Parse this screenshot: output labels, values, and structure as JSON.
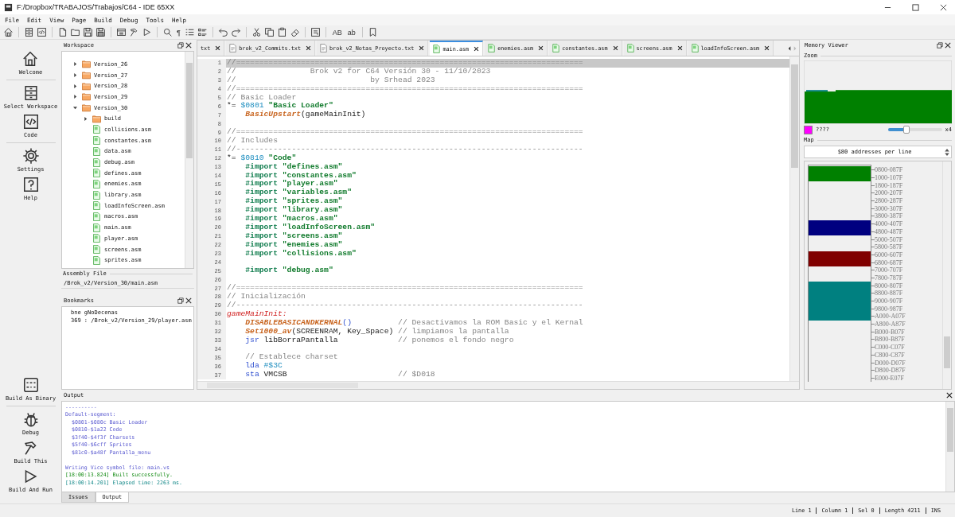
{
  "window": {
    "title": "F:/Dropbox/TRABAJOS/Trabajos/C64 - IDE 65XX"
  },
  "menu": [
    "File",
    "Edit",
    "View",
    "Page",
    "Build",
    "Debug",
    "Tools",
    "Help"
  ],
  "toolbar": [
    {
      "kind": "home"
    },
    {
      "kind": "separator"
    },
    {
      "kind": "cabinet"
    },
    {
      "kind": "code"
    },
    {
      "kind": "separator"
    },
    {
      "kind": "file"
    },
    {
      "kind": "folder"
    },
    {
      "kind": "save"
    },
    {
      "kind": "saveall"
    },
    {
      "kind": "separator"
    },
    {
      "kind": "panel"
    },
    {
      "kind": "hammer"
    },
    {
      "kind": "play"
    },
    {
      "kind": "separator"
    },
    {
      "kind": "search"
    },
    {
      "kind": "text",
      "label": "¶"
    },
    {
      "kind": "list"
    },
    {
      "kind": "checklist"
    },
    {
      "kind": "separator"
    },
    {
      "kind": "undo"
    },
    {
      "kind": "redo"
    },
    {
      "kind": "separator"
    },
    {
      "kind": "cut"
    },
    {
      "kind": "copy"
    },
    {
      "kind": "paste"
    },
    {
      "kind": "eraser"
    },
    {
      "kind": "separator"
    },
    {
      "kind": "block"
    },
    {
      "kind": "separator"
    },
    {
      "kind": "text",
      "label": "AB"
    },
    {
      "kind": "text",
      "label": "ab"
    },
    {
      "kind": "separator"
    },
    {
      "kind": "bookmark"
    }
  ],
  "sidebar": {
    "top": [
      {
        "kind": "home",
        "label": "Welcome"
      },
      {
        "kind": "cabinet",
        "label": "Select Workspace"
      },
      {
        "kind": "code",
        "label": "Code"
      },
      {
        "kind": "gear",
        "label": "Settings"
      },
      {
        "kind": "help",
        "label": "Help"
      }
    ],
    "bottom": [
      {
        "kind": "binary",
        "label": "Build As Binary"
      },
      {
        "kind": "bug",
        "label": "Debug"
      },
      {
        "kind": "hammer",
        "label": "Build This"
      },
      {
        "kind": "play",
        "label": "Build And Run"
      }
    ]
  },
  "workspace": {
    "title": "Workspace",
    "tree": [
      {
        "name": "Version_26",
        "kind": "folder",
        "expanded": false
      },
      {
        "name": "Version_27",
        "kind": "folder",
        "expanded": false
      },
      {
        "name": "Version_28",
        "kind": "folder",
        "expanded": false
      },
      {
        "name": "Version_29",
        "kind": "folder",
        "expanded": false
      },
      {
        "name": "Version_30",
        "kind": "folder",
        "expanded": true,
        "children": [
          {
            "name": "build",
            "kind": "folder",
            "expanded": false
          },
          {
            "name": "collisions.asm",
            "kind": "asm"
          },
          {
            "name": "constantes.asm",
            "kind": "asm"
          },
          {
            "name": "data.asm",
            "kind": "asm"
          },
          {
            "name": "debug.asm",
            "kind": "asm"
          },
          {
            "name": "defines.asm",
            "kind": "asm"
          },
          {
            "name": "enemies.asm",
            "kind": "asm"
          },
          {
            "name": "library.asm",
            "kind": "asm"
          },
          {
            "name": "loadInfoScreen.asm",
            "kind": "asm"
          },
          {
            "name": "macros.asm",
            "kind": "asm"
          },
          {
            "name": "main.asm",
            "kind": "asm"
          },
          {
            "name": "player.asm",
            "kind": "asm"
          },
          {
            "name": "screens.asm",
            "kind": "asm"
          },
          {
            "name": "sprites.asm",
            "kind": "asm"
          }
        ]
      }
    ],
    "assembly_file_label": "Assembly File",
    "assembly_file": "/Brok_v2/Version_30/main.asm"
  },
  "bookmarks": {
    "title": "Bookmarks",
    "items": [
      {
        "instruction": "bne gNoDecenas",
        "location": "369 : /Brok_v2/Version_29/player.asm"
      }
    ]
  },
  "editor": {
    "tabs": [
      {
        "label": "txt",
        "kind": "cut",
        "selected": false
      },
      {
        "label": "brok_v2_Commits.txt",
        "kind": "txt",
        "selected": false
      },
      {
        "label": "brok_v2_Notas_Proyecto.txt",
        "kind": "txt",
        "selected": false
      },
      {
        "label": "main.asm",
        "kind": "asm",
        "selected": true
      },
      {
        "label": "enemies.asm",
        "kind": "asm",
        "selected": false
      },
      {
        "label": "constantes.asm",
        "kind": "asm",
        "selected": false
      },
      {
        "label": "screens.asm",
        "kind": "asm",
        "selected": false
      },
      {
        "label": "loadInfoScreen.asm",
        "kind": "asm",
        "selected": false
      }
    ],
    "lines": [
      {
        "number": "1",
        "current": true,
        "segments": [
          {
            "kind": "comment",
            "text": "//==========================================================================="
          }
        ]
      },
      {
        "number": "2",
        "current": false,
        "segments": [
          {
            "kind": "comment",
            "text": "//                Brok v2 for C64 Versión 30 - 11/10/2023"
          }
        ]
      },
      {
        "number": "3",
        "current": false,
        "segments": [
          {
            "kind": "comment",
            "text": "//                             by Srhead 2023"
          }
        ]
      },
      {
        "number": "4",
        "current": false,
        "segments": [
          {
            "kind": "comment",
            "text": "//==========================================================================="
          }
        ]
      },
      {
        "number": "5",
        "current": false,
        "segments": [
          {
            "kind": "comment",
            "text": "// Basic Loader"
          }
        ]
      },
      {
        "number": "6",
        "current": false,
        "segments": [
          {
            "kind": "plain",
            "text": "*= "
          },
          {
            "kind": "number",
            "text": "$0801"
          },
          {
            "kind": "string",
            "text": " \"Basic Loader\""
          }
        ]
      },
      {
        "number": "7",
        "current": false,
        "segments": [
          {
            "kind": "macro",
            "text": "    BasicUpstart"
          },
          {
            "kind": "plain",
            "text": "(gameMainInit)"
          }
        ]
      },
      {
        "number": "8",
        "current": false
      },
      {
        "number": "9",
        "current": false,
        "segments": [
          {
            "kind": "comment",
            "text": "//==========================================================================="
          }
        ]
      },
      {
        "number": "10",
        "current": false,
        "segments": [
          {
            "kind": "comment",
            "text": "// Includes"
          }
        ]
      },
      {
        "number": "11",
        "current": false,
        "segments": [
          {
            "kind": "comment",
            "text": "//---------------------------------------------------------------------------"
          }
        ]
      },
      {
        "number": "12",
        "current": false,
        "segments": [
          {
            "kind": "plain",
            "text": "*= "
          },
          {
            "kind": "number",
            "text": "$0810"
          },
          {
            "kind": "string",
            "text": " \"Code\""
          }
        ]
      },
      {
        "number": "13",
        "current": false,
        "segments": [
          {
            "kind": "directive",
            "text": "    #import"
          },
          {
            "kind": "string",
            "text": " \"defines.asm\""
          }
        ]
      },
      {
        "number": "14",
        "current": false,
        "segments": [
          {
            "kind": "directive",
            "text": "    #import"
          },
          {
            "kind": "string",
            "text": " \"constantes.asm\""
          }
        ]
      },
      {
        "number": "15",
        "current": false,
        "segments": [
          {
            "kind": "directive",
            "text": "    #import"
          },
          {
            "kind": "string",
            "text": " \"player.asm\""
          }
        ]
      },
      {
        "number": "16",
        "current": false,
        "segments": [
          {
            "kind": "directive",
            "text": "    #import"
          },
          {
            "kind": "string",
            "text": " \"variables.asm\""
          }
        ]
      },
      {
        "number": "17",
        "current": false,
        "segments": [
          {
            "kind": "directive",
            "text": "    #import"
          },
          {
            "kind": "string",
            "text": " \"sprites.asm\""
          }
        ]
      },
      {
        "number": "18",
        "current": false,
        "segments": [
          {
            "kind": "directive",
            "text": "    #import"
          },
          {
            "kind": "string",
            "text": " \"library.asm\""
          }
        ]
      },
      {
        "number": "19",
        "current": false,
        "segments": [
          {
            "kind": "directive",
            "text": "    #import"
          },
          {
            "kind": "string",
            "text": " \"macros.asm\""
          }
        ]
      },
      {
        "number": "20",
        "current": false,
        "segments": [
          {
            "kind": "directive",
            "text": "    #import"
          },
          {
            "kind": "string",
            "text": " \"loadInfoScreen.asm\""
          }
        ]
      },
      {
        "number": "21",
        "current": false,
        "segments": [
          {
            "kind": "directive",
            "text": "    #import"
          },
          {
            "kind": "string",
            "text": " \"screens.asm\""
          }
        ]
      },
      {
        "number": "22",
        "current": false,
        "segments": [
          {
            "kind": "directive",
            "text": "    #import"
          },
          {
            "kind": "string",
            "text": " \"enemies.asm\""
          }
        ]
      },
      {
        "number": "23",
        "current": false,
        "segments": [
          {
            "kind": "directive",
            "text": "    #import"
          },
          {
            "kind": "string",
            "text": " \"collisions.asm\""
          }
        ]
      },
      {
        "number": "24",
        "current": false
      },
      {
        "number": "25",
        "current": false,
        "segments": [
          {
            "kind": "directive",
            "text": "    #import"
          },
          {
            "kind": "string",
            "text": " \"debug.asm\""
          }
        ]
      },
      {
        "number": "26",
        "current": false
      },
      {
        "number": "27",
        "current": false,
        "segments": [
          {
            "kind": "comment",
            "text": "//==========================================================================="
          }
        ]
      },
      {
        "number": "28",
        "current": false,
        "segments": [
          {
            "kind": "comment",
            "text": "// Inicialización"
          }
        ]
      },
      {
        "number": "29",
        "current": false,
        "segments": [
          {
            "kind": "comment",
            "text": "//---------------------------------------------------------------------------"
          }
        ]
      },
      {
        "number": "30",
        "current": false,
        "segments": [
          {
            "kind": "label",
            "text": "gameMainInit:"
          }
        ]
      },
      {
        "number": "31",
        "current": false,
        "segments": [
          {
            "kind": "macro",
            "text": "    DISABLEBASICANDKERNAL"
          },
          {
            "kind": "paren",
            "text": "()"
          },
          {
            "kind": "comment",
            "text": "          // Desactivamos la ROM Basic y el Kernal"
          }
        ]
      },
      {
        "number": "32",
        "current": false,
        "segments": [
          {
            "kind": "macro",
            "text": "    Set1000_av"
          },
          {
            "kind": "plain",
            "text": "(SCREENRAM, Key_Space)"
          },
          {
            "kind": "comment",
            "text": " // limpiamos la pantalla"
          }
        ]
      },
      {
        "number": "33",
        "current": false,
        "segments": [
          {
            "kind": "mnemonic",
            "text": "    jsr"
          },
          {
            "kind": "plain",
            "text": " libBorraPantalla"
          },
          {
            "kind": "comment",
            "text": "             // ponemos el fondo negro"
          }
        ]
      },
      {
        "number": "34",
        "current": false
      },
      {
        "number": "35",
        "current": false,
        "segments": [
          {
            "kind": "comment",
            "text": "    // Establece charset"
          }
        ]
      },
      {
        "number": "36",
        "current": false,
        "segments": [
          {
            "kind": "mnemonic",
            "text": "    lda"
          },
          {
            "kind": "number",
            "text": " #$3C"
          }
        ]
      },
      {
        "number": "37",
        "current": false,
        "segments": [
          {
            "kind": "mnemonic",
            "text": "    sta"
          },
          {
            "kind": "plain",
            "text": " VMCSB"
          },
          {
            "kind": "comment",
            "text": "                        // $D018"
          }
        ]
      }
    ]
  },
  "memory_viewer": {
    "title": "Memory Viewer",
    "zoom_label": "Zoom",
    "legend_label": "????",
    "slider": {
      "level": 0.35
    },
    "zoom_factor": "x4",
    "map_label": "Map",
    "resolution": "$80 addresses per line",
    "map": [
      {
        "range": "0800-087F",
        "color": "#008000"
      },
      {
        "range": "1000-107F",
        "color": "#008000"
      },
      {
        "range": "1800-187F"
      },
      {
        "range": "2000-207F"
      },
      {
        "range": "2800-287F"
      },
      {
        "range": "3000-307F"
      },
      {
        "range": "3800-387F"
      },
      {
        "range": "4000-407F",
        "color": "#000080"
      },
      {
        "range": "4800-487F",
        "color": "#000080"
      },
      {
        "range": "5000-507F"
      },
      {
        "range": "5800-587F"
      },
      {
        "range": "6000-607F",
        "color": "#800000"
      },
      {
        "range": "6800-687F",
        "color": "#800000"
      },
      {
        "range": "7000-707F"
      },
      {
        "range": "7800-787F"
      },
      {
        "range": "8000-807F",
        "color": "#008080"
      },
      {
        "range": "8800-887F",
        "color": "#008080"
      },
      {
        "range": "9000-907F",
        "color": "#008080"
      },
      {
        "range": "9800-987F",
        "color": "#008080"
      },
      {
        "range": "A000-A07F",
        "color": "#008080"
      },
      {
        "range": "A800-A87F"
      },
      {
        "range": "B000-B07F"
      },
      {
        "range": "B800-B87F"
      },
      {
        "range": "C000-C07F"
      },
      {
        "range": "C800-C87F"
      },
      {
        "range": "D000-D07F"
      },
      {
        "range": "D800-D87F"
      },
      {
        "range": "E000-E07F"
      }
    ]
  },
  "output": {
    "title": "Output",
    "lines": [
      {
        "kind": "info",
        "text": "----------"
      },
      {
        "kind": "info",
        "text": "Default-segment:"
      },
      {
        "kind": "info",
        "text": "  $0801-$080c Basic Loader"
      },
      {
        "kind": "info",
        "text": "  $0810-$1a22 Code"
      },
      {
        "kind": "info",
        "text": "  $3f40-$4f3f Charsets"
      },
      {
        "kind": "info",
        "text": "  $5f40-$6cff Sprites"
      },
      {
        "kind": "info",
        "text": "  $81c0-$a48f Pantalla_menu"
      },
      {
        "kind": "blank"
      },
      {
        "kind": "info",
        "text": "Writing Vice symbol file: main.vs"
      },
      {
        "kind": "success",
        "text": "[18:00:13.824] Built successfully."
      },
      {
        "kind": "time",
        "text": "[18:00:14.201] Elapsed time: 2263 ms."
      }
    ],
    "tabs": [
      {
        "label": "Issues",
        "selected": false
      },
      {
        "label": "Output",
        "selected": true
      }
    ]
  },
  "status_bar": [
    "Line 1",
    "Column 1",
    "Sel 0",
    "Length 4211",
    "INS"
  ]
}
